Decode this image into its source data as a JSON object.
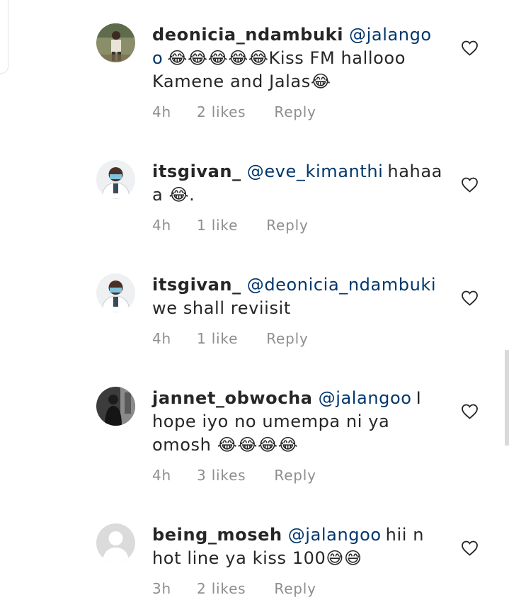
{
  "comments": [
    {
      "username": "deonicia_ndambuki",
      "mention": "@jalangoo",
      "text": "😂😂😂😂😂Kiss FM hallooo Kamene and Jalas😂",
      "time": "4h",
      "likes": "2 likes",
      "reply": "Reply",
      "avatar_icon": "person-outdoors-avatar"
    },
    {
      "username": "itsgivan_",
      "mention": "@eve_kimanthi",
      "text": "hahaaa 😂.",
      "time": "4h",
      "likes": "1 like",
      "reply": "Reply",
      "avatar_icon": "doctor-avatar"
    },
    {
      "username": "itsgivan_",
      "mention": "@deonicia_ndambuki",
      "text": "we shall reviisit",
      "time": "4h",
      "likes": "1 like",
      "reply": "Reply",
      "avatar_icon": "doctor-avatar"
    },
    {
      "username": "jannet_obwocha",
      "mention": "@jalangoo",
      "text": "I hope iyo no umempa ni ya omosh 😂😂😂😂",
      "time": "4h",
      "likes": "3 likes",
      "reply": "Reply",
      "avatar_icon": "dark-photo-avatar"
    },
    {
      "username": "being_moseh",
      "mention": "@jalangoo",
      "text": "hii n hot line ya kiss 100😅😅",
      "time": "3h",
      "likes": "2 likes",
      "reply": "Reply",
      "avatar_icon": "default-user-avatar"
    }
  ],
  "colors": {
    "mention": "#00376b",
    "meta": "#8e8e8e",
    "text": "#262626"
  },
  "icons": {
    "like": "heart-outline-icon"
  }
}
